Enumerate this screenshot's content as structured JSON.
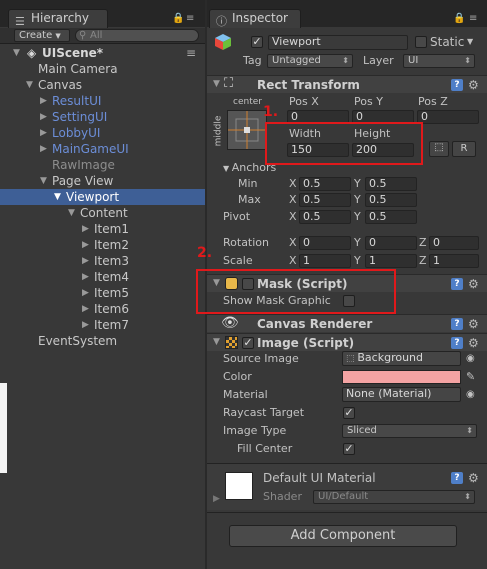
{
  "hierarchy": {
    "tab_label": "Hierarchy",
    "create_label": "Create",
    "search_placeholder": "All",
    "scene_name": "UIScene*",
    "items": [
      {
        "label": "Main Camera",
        "depth": 1,
        "style": "normal"
      },
      {
        "label": "Canvas",
        "depth": 1,
        "style": "normal",
        "expanded": true
      },
      {
        "label": "ResultUI",
        "depth": 2,
        "style": "blue"
      },
      {
        "label": "SettingUI",
        "depth": 2,
        "style": "blue"
      },
      {
        "label": "LobbyUI",
        "depth": 2,
        "style": "blue"
      },
      {
        "label": "MainGameUI",
        "depth": 2,
        "style": "blue"
      },
      {
        "label": "RawImage",
        "depth": 2,
        "style": "dim"
      },
      {
        "label": "Page View",
        "depth": 2,
        "style": "normal",
        "expanded": true
      },
      {
        "label": "Viewport",
        "depth": 3,
        "style": "selected",
        "expanded": true
      },
      {
        "label": "Content",
        "depth": 4,
        "style": "normal",
        "expanded": true
      },
      {
        "label": "Item1",
        "depth": 5,
        "style": "normal"
      },
      {
        "label": "Item2",
        "depth": 5,
        "style": "normal"
      },
      {
        "label": "Item3",
        "depth": 5,
        "style": "normal"
      },
      {
        "label": "Item4",
        "depth": 5,
        "style": "normal"
      },
      {
        "label": "Item5",
        "depth": 5,
        "style": "normal"
      },
      {
        "label": "Item6",
        "depth": 5,
        "style": "normal"
      },
      {
        "label": "Item7",
        "depth": 5,
        "style": "normal"
      },
      {
        "label": "EventSystem",
        "depth": 1,
        "style": "normal"
      }
    ]
  },
  "inspector": {
    "tab_label": "Inspector",
    "object_name": "Viewport",
    "static_label": "Static",
    "tag_label": "Tag",
    "tag_value": "Untagged",
    "layer_label": "Layer",
    "layer_value": "UI",
    "rect_transform": {
      "title": "Rect Transform",
      "anchor_preset_top": "center",
      "anchor_preset_side": "middle",
      "pos_x_label": "Pos X",
      "pos_y_label": "Pos Y",
      "pos_z_label": "Pos Z",
      "pos_x": "0",
      "pos_y": "0",
      "pos_z": "0",
      "width_label": "Width",
      "height_label": "Height",
      "width": "150",
      "height": "200",
      "r_button": "R",
      "anchors_label": "Anchors",
      "min_label": "Min",
      "max_label": "Max",
      "min_x": "0.5",
      "min_y": "0.5",
      "max_x": "0.5",
      "max_y": "0.5",
      "pivot_label": "Pivot",
      "pivot_x": "0.5",
      "pivot_y": "0.5",
      "rotation_label": "Rotation",
      "rot_x": "0",
      "rot_y": "0",
      "rot_z": "0",
      "scale_label": "Scale",
      "scale_x": "1",
      "scale_y": "1",
      "scale_z": "1",
      "x_label": "X",
      "y_label": "Y",
      "z_label": "Z"
    },
    "mask": {
      "title": "Mask (Script)",
      "show_graphic_label": "Show Mask Graphic",
      "enabled": false
    },
    "canvas_renderer": {
      "title": "Canvas Renderer"
    },
    "image": {
      "title": "Image (Script)",
      "source_image_label": "Source Image",
      "source_image_value": "Background",
      "color_label": "Color",
      "color_value": "#f4a3a3",
      "material_label": "Material",
      "material_value": "None (Material)",
      "raycast_label": "Raycast Target",
      "image_type_label": "Image Type",
      "image_type_value": "Sliced",
      "fill_center_label": "Fill Center"
    },
    "material_preview": {
      "name": "Default UI Material",
      "shader_label": "Shader",
      "shader_value": "UI/Default"
    },
    "add_component_label": "Add Component"
  },
  "annotations": {
    "one": "1.",
    "two": "2."
  }
}
